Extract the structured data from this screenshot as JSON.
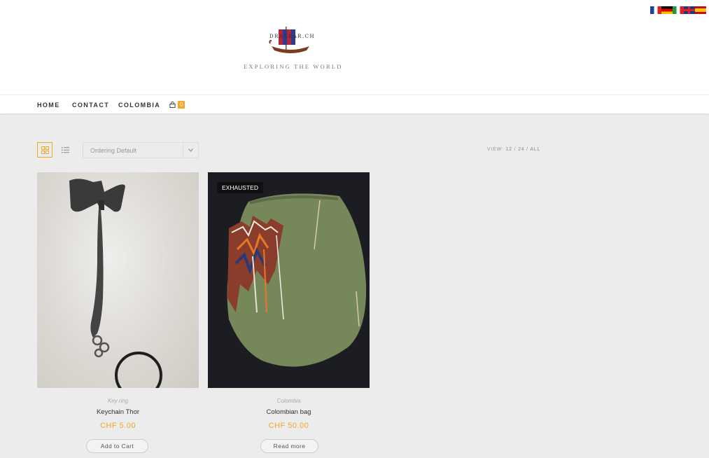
{
  "header": {
    "logo_text": "DRAKKAR.CH",
    "tagline": "EXPLORING THE WORLD",
    "languages": [
      "French",
      "German",
      "Italian",
      "English",
      "Spanish"
    ]
  },
  "nav": {
    "items": [
      "HOME",
      "CONTACT",
      "COLOMBIA"
    ],
    "cart_count": "0"
  },
  "toolbar": {
    "ordering": "Ordering Default",
    "view_label": "VIEW:",
    "view_options": [
      "12",
      "24",
      "ALL"
    ],
    "view_sep": "/"
  },
  "products": [
    {
      "category": "Key ring",
      "name": "Keychain Thor",
      "price": "CHF 5.00",
      "button": "Add to Cart",
      "badge": ""
    },
    {
      "category": "Colombia",
      "name": "Colombian bag",
      "price": "CHF 50.00",
      "button": "Read more",
      "badge": "EXHAUSTED"
    }
  ],
  "colors": {
    "accent": "#f5a623",
    "background": "#ececec"
  }
}
